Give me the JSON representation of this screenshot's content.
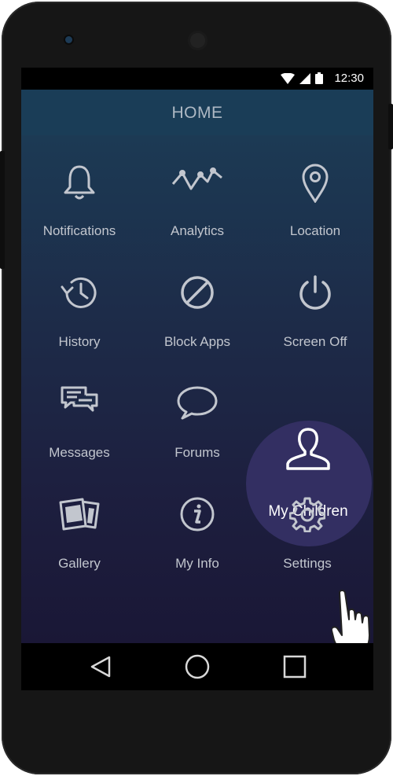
{
  "status_bar": {
    "time": "12:30"
  },
  "app_bar": {
    "title": "HOME"
  },
  "menu": {
    "items": [
      {
        "label": "Notifications",
        "icon": "bell-icon"
      },
      {
        "label": "Analytics",
        "icon": "analytics-icon"
      },
      {
        "label": "Location",
        "icon": "location-pin-icon"
      },
      {
        "label": "History",
        "icon": "history-icon"
      },
      {
        "label": "Block Apps",
        "icon": "block-icon"
      },
      {
        "label": "Screen Off",
        "icon": "power-icon"
      },
      {
        "label": "Messages",
        "icon": "messages-icon"
      },
      {
        "label": "Forums",
        "icon": "chat-bubble-icon"
      },
      {
        "label": "My Children",
        "icon": "user-icon",
        "active": true
      },
      {
        "label": "Gallery",
        "icon": "gallery-icon"
      },
      {
        "label": "My Info",
        "icon": "info-icon"
      },
      {
        "label": "Settings",
        "icon": "gear-icon"
      }
    ]
  },
  "nav_bar": {
    "back": "back-icon",
    "home": "home-icon",
    "recents": "recents-icon"
  },
  "colors": {
    "app_bar": "#1a3d57",
    "highlight": "#332f62",
    "icon": "#c2c6ce"
  }
}
